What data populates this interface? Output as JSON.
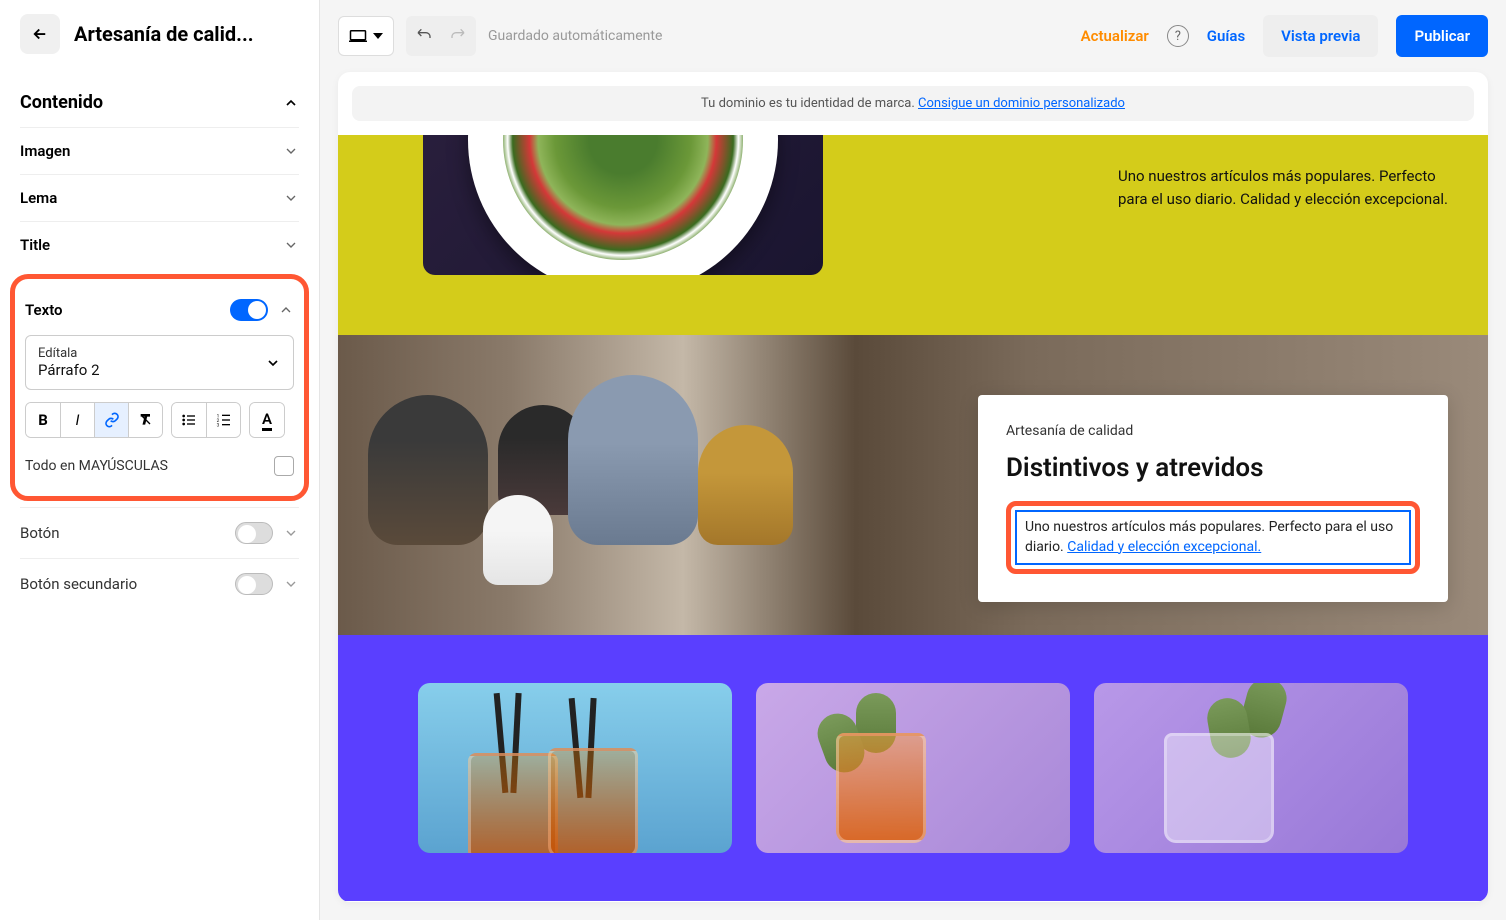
{
  "sidebar": {
    "title": "Artesanía de calid...",
    "content_header": "Contenido",
    "sections": {
      "imagen": "Imagen",
      "lema": "Lema",
      "title": "Title",
      "texto": "Texto",
      "boton": "Botón",
      "boton_secundario": "Botón secundario"
    },
    "style_select": {
      "label": "Edítala",
      "value": "Párrafo 2"
    },
    "uppercase_label": "Todo en MAYÚSCULAS"
  },
  "toolbar": {
    "save_status": "Guardado automáticamente",
    "actualizar": "Actualizar",
    "guias": "Guías",
    "vista_previa": "Vista previa",
    "publicar": "Publicar"
  },
  "banner": {
    "text": "Tu dominio es tu identidad de marca. ",
    "link": "Consigue un dominio personalizado"
  },
  "preview": {
    "yellow_text": "Uno nuestros artículos más populares. Perfecto para el uso diario. Calidad y elección excepcional.",
    "card": {
      "subtitle": "Artesanía de calidad",
      "title": "Distintivos y atrevidos",
      "text_plain": "Uno nuestros artículos más populares. Perfecto para el uso diario. ",
      "text_linked": "Calidad y elección excepcional."
    }
  }
}
